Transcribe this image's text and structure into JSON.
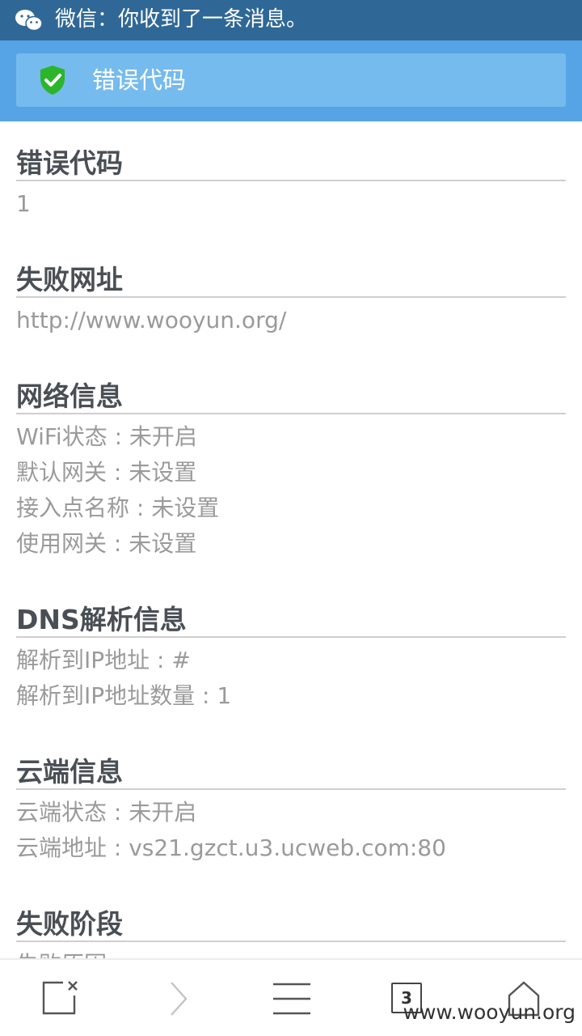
{
  "notification": {
    "app_icon": "wechat-icon",
    "text": "微信：你收到了一条消息。"
  },
  "banner": {
    "icon": "shield-check-icon",
    "title": "错误代码"
  },
  "sections": [
    {
      "title": "错误代码",
      "lines": [
        "1"
      ]
    },
    {
      "title": "失败网址",
      "lines": [
        "http://www.wooyun.org/"
      ]
    },
    {
      "title": "网络信息",
      "lines": [
        "WiFi状态 : 未开启",
        "默认网关 : 未设置",
        "接入点名称 : 未设置",
        "使用网关 : 未设置"
      ]
    },
    {
      "title": "DNS解析信息",
      "lines": [
        "解析到IP地址 : #",
        "解析到IP地址数量 : 1"
      ]
    },
    {
      "title": "云端信息",
      "lines": [
        "云端状态 : 未开启",
        "云端地址 : vs21.gzct.u3.ucweb.com:80"
      ]
    },
    {
      "title": "失败阶段",
      "lines": [
        "失败原因"
      ]
    }
  ],
  "toolbar": {
    "close_icon": "close-window-icon",
    "forward_icon": "forward-icon",
    "menu_icon": "menu-icon",
    "tab_count": "3",
    "home_icon": "home-icon"
  },
  "watermark": "www.wooyun.org",
  "colors": {
    "statusbar": "#2f6896",
    "header": "#56a4e6",
    "banner": "#75bbed",
    "shield": "#2cb52a"
  }
}
